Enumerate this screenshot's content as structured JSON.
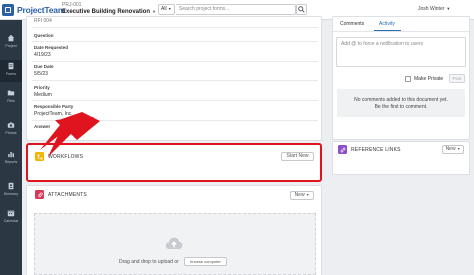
{
  "app": {
    "name": "ProjectTeam"
  },
  "header": {
    "project_id": "PRJ-001",
    "project_name": "Executive Building Renovation",
    "scope_label": "All",
    "search_placeholder": "Search project forms...",
    "user_name": "Josh Winter"
  },
  "sidebar": {
    "items": [
      {
        "label": "Project",
        "icon": "home-icon"
      },
      {
        "label": "Forms",
        "icon": "forms-icon"
      },
      {
        "label": "Files",
        "icon": "folder-icon"
      },
      {
        "label": "Photos",
        "icon": "camera-icon"
      },
      {
        "label": "Reports",
        "icon": "reports-icon"
      },
      {
        "label": "Directory",
        "icon": "directory-icon"
      },
      {
        "label": "Calendar",
        "icon": "calendar-icon"
      }
    ]
  },
  "form": {
    "top_value": "RFI 004",
    "fields": [
      {
        "label": "Question",
        "value": ""
      },
      {
        "label": "Date Requested",
        "value": "4/19/23"
      },
      {
        "label": "Due Date",
        "value": "5/5/23"
      },
      {
        "label": "Priority",
        "value": "Medium"
      },
      {
        "label": "Responsible Party",
        "value": "ProjectTeam, Inc."
      },
      {
        "label": "Answer",
        "value": ""
      }
    ]
  },
  "workflows": {
    "title": "WORKFLOWS",
    "button": "Start New"
  },
  "attachments": {
    "title": "ATTACHMENTS",
    "button": "New",
    "drop_text": "Drag and drop to upload or",
    "browse_button": "browse computer"
  },
  "comments": {
    "tabs": [
      "Comments",
      "Activity"
    ],
    "placeholder": "Add @ to force a notification to users",
    "private_label": "Make Private",
    "post_button": "Post",
    "empty_line1": "No comments added to this document yet.",
    "empty_line2": "Be the first to comment."
  },
  "reference_links": {
    "title": "REFERENCE LINKS",
    "button": "New"
  },
  "colors": {
    "brand": "#2a5fa8",
    "sidebar": "#2b3743",
    "highlight": "#e0141e",
    "workflow_icon": "#f4b400",
    "attachment_icon": "#d63a5a",
    "reference_icon": "#8a4fc9"
  }
}
